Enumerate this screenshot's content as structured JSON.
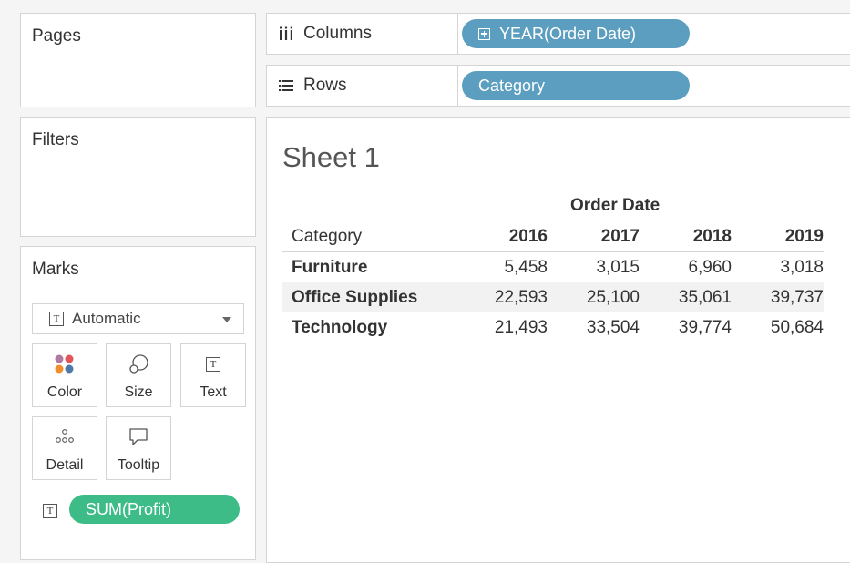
{
  "pages_panel": {
    "title": "Pages"
  },
  "filters_panel": {
    "title": "Filters"
  },
  "marks_panel": {
    "title": "Marks",
    "mark_type": "Automatic",
    "buttons": {
      "color": "Color",
      "size": "Size",
      "text": "Text",
      "detail": "Detail",
      "tooltip": "Tooltip"
    },
    "measure_pill": "SUM(Profit)"
  },
  "columns_shelf": {
    "label": "Columns",
    "pill": "YEAR(Order Date)"
  },
  "rows_shelf": {
    "label": "Rows",
    "pill": "Category"
  },
  "sheet": {
    "title": "Sheet 1",
    "column_group_header": "Order Date",
    "row_header": "Category",
    "years": [
      "2016",
      "2017",
      "2018",
      "2019"
    ],
    "rows": [
      {
        "category": "Furniture",
        "values": [
          "5,458",
          "3,015",
          "6,960",
          "3,018"
        ]
      },
      {
        "category": "Office Supplies",
        "values": [
          "22,593",
          "25,100",
          "35,061",
          "39,737"
        ]
      },
      {
        "category": "Technology",
        "values": [
          "21,493",
          "33,504",
          "39,774",
          "50,684"
        ]
      }
    ]
  },
  "colors": {
    "dimension_pill": "#5b9ec0",
    "measure_pill": "#3dbc87"
  }
}
